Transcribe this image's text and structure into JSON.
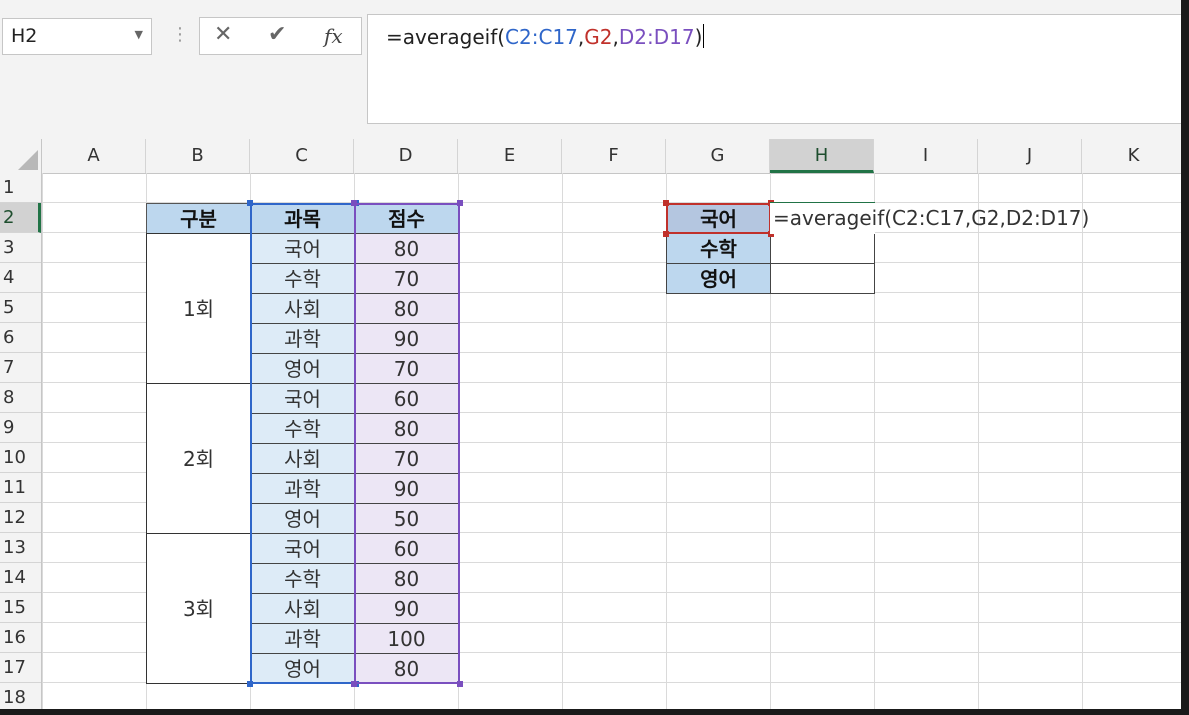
{
  "name_box": {
    "value": "H2"
  },
  "formula_bar": {
    "prefix": "=averageif(",
    "arg1": "C2:C17",
    "sep1": ",",
    "arg2": "G2",
    "sep2": ",",
    "arg3": "D2:D17",
    "suffix": ")",
    "icons": [
      "cancel-icon",
      "enter-icon",
      "fx-icon"
    ],
    "fx_label": "fx"
  },
  "columns": [
    "A",
    "B",
    "C",
    "D",
    "E",
    "F",
    "G",
    "H",
    "I",
    "J",
    "K"
  ],
  "rows": [
    "1",
    "2",
    "3",
    "4",
    "5",
    "6",
    "7",
    "8",
    "9",
    "10",
    "11",
    "12",
    "13",
    "14",
    "15",
    "16",
    "17",
    "18"
  ],
  "selected": {
    "column": "H",
    "row": "2"
  },
  "table": {
    "headers": {
      "group": "구분",
      "subject": "과목",
      "score": "점수"
    },
    "groups": [
      {
        "label": "1회",
        "rows": [
          {
            "subject": "국어",
            "score": "80"
          },
          {
            "subject": "수학",
            "score": "70"
          },
          {
            "subject": "사회",
            "score": "80"
          },
          {
            "subject": "과학",
            "score": "90"
          },
          {
            "subject": "영어",
            "score": "70"
          }
        ]
      },
      {
        "label": "2회",
        "rows": [
          {
            "subject": "국어",
            "score": "60"
          },
          {
            "subject": "수학",
            "score": "80"
          },
          {
            "subject": "사회",
            "score": "70"
          },
          {
            "subject": "과학",
            "score": "90"
          },
          {
            "subject": "영어",
            "score": "50"
          }
        ]
      },
      {
        "label": "3회",
        "rows": [
          {
            "subject": "국어",
            "score": "60"
          },
          {
            "subject": "수학",
            "score": "80"
          },
          {
            "subject": "사회",
            "score": "90"
          },
          {
            "subject": "과학",
            "score": "100"
          },
          {
            "subject": "영어",
            "score": "80"
          }
        ]
      }
    ]
  },
  "summary": {
    "labels": [
      "국어",
      "수학",
      "영어"
    ],
    "h2_edit_text": "=averageif(C2:C17,G2,D2:D17)"
  },
  "colors": {
    "header_fill": "#bdd7ee",
    "subject_fill": "#ddebf7",
    "score_fill": "#ece6f5",
    "ref_blue": "#2f66c9",
    "ref_red": "#c0312b",
    "ref_purple": "#7a4fbf",
    "excel_green": "#217346"
  }
}
